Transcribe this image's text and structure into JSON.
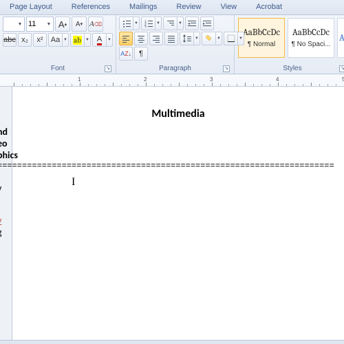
{
  "ribbon_tabs": [
    "Page Layout",
    "References",
    "Mailings",
    "Review",
    "View",
    "Acrobat"
  ],
  "font": {
    "size_value": "11",
    "grow": "A",
    "shrink": "A",
    "strike": "abc",
    "sub": "x₂",
    "sup": "x²",
    "case": "Aa",
    "highlight": "ab",
    "color": "A",
    "group_label": "Font"
  },
  "para": {
    "group_label": "Paragraph",
    "pilcrow": "¶"
  },
  "styles": {
    "group_label": "Styles",
    "items": [
      {
        "preview": "AaBbCcDc",
        "name": "¶ Normal"
      },
      {
        "preview": "AaBbCcDc",
        "name": "¶ No Spaci..."
      },
      {
        "preview": "A",
        "name": ""
      }
    ]
  },
  "ruler": {
    "marks": [
      "1",
      "2",
      "3",
      "4",
      "5"
    ]
  },
  "doc": {
    "title": "Multimedia",
    "lines": [
      "nd",
      "eo",
      "phics"
    ],
    "divider": "====================================================================",
    "tail": [
      "v",
      "s",
      "",
      "v",
      "g",
      ""
    ]
  }
}
